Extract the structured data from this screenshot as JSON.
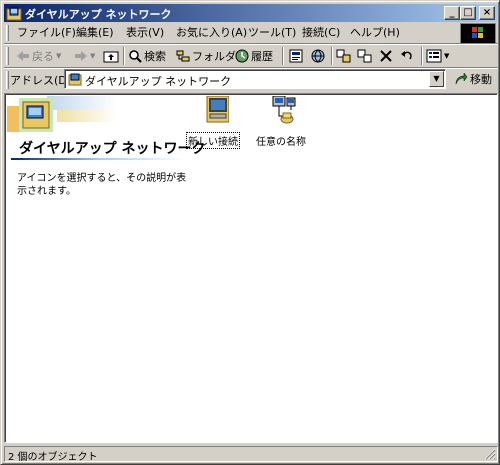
{
  "window": {
    "title": "ダイヤルアップ ネットワーク",
    "minimize_label": "_",
    "maximize_label": "□",
    "close_label": "×"
  },
  "menubar": {
    "items": [
      {
        "label": "ファイル(F)"
      },
      {
        "label": "編集(E)"
      },
      {
        "label": "表示(V)"
      },
      {
        "label": "お気に入り(A)"
      },
      {
        "label": "ツール(T)"
      },
      {
        "label": "接続(C)"
      },
      {
        "label": "ヘルプ(H)"
      }
    ]
  },
  "toolbar": {
    "back_label": "戻る",
    "search_label": "検索",
    "folders_label": "フォルダ",
    "history_label": "履歴"
  },
  "address": {
    "label": "アドレス(D)",
    "value": "ダイヤルアップ ネットワーク",
    "go_label": "移動"
  },
  "content": {
    "banner_title": "ダイヤルアップ ネットワーク",
    "info_text": "アイコンを選択すると、その説明が表示されます。",
    "items": [
      {
        "label": "新しい接続"
      },
      {
        "label": "任意の名称"
      }
    ]
  },
  "statusbar": {
    "text": "2 個のオブジェクト"
  },
  "colors": {
    "title_start": "#0a246a",
    "title_end": "#a6caf0",
    "face": "#d4d0c8"
  }
}
